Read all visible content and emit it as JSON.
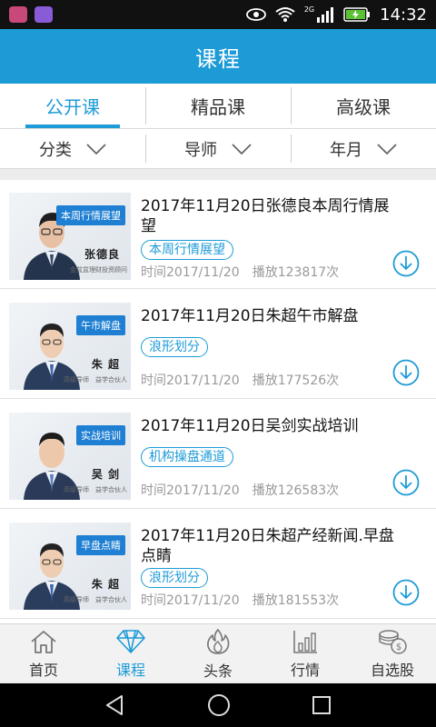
{
  "status": {
    "time": "14:32",
    "network": "2G"
  },
  "header": {
    "title": "课程"
  },
  "tabs": [
    {
      "label": "公开课",
      "active": true
    },
    {
      "label": "精品课",
      "active": false
    },
    {
      "label": "高级课",
      "active": false
    }
  ],
  "filters": [
    {
      "label": "分类"
    },
    {
      "label": "导师"
    },
    {
      "label": "年月"
    }
  ],
  "courses": [
    {
      "title": "2017年11月20日张德良本周行情展望",
      "tag": "本周行情展望",
      "time": "时间2017/11/20",
      "plays": "播放123817次",
      "thumb_tag": "本周行情展望",
      "thumb_name": "张德良",
      "thumb_sub": "金盆盆理财投资顾问"
    },
    {
      "title": "2017年11月20日朱超午市解盘",
      "tag": "浪形划分",
      "time": "时间2017/11/20",
      "plays": "播放177526次",
      "thumb_tag": "午市解盘",
      "thumb_name": "朱 超",
      "thumb_sub": "高级导师　益学合伙人"
    },
    {
      "title": "2017年11月20日吴剑实战培训",
      "tag": "机构操盘通道",
      "time": "时间2017/11/20",
      "plays": "播放126583次",
      "thumb_tag": "实战培训",
      "thumb_name": "吴 剑",
      "thumb_sub": "高级导师　益学合伙人"
    },
    {
      "title": "2017年11月20日朱超产经新闻.早盘点睛",
      "tag": "浪形划分",
      "time": "时间2017/11/20",
      "plays": "播放181553次",
      "thumb_tag": "早盘点睛",
      "thumb_name": "朱 超",
      "thumb_sub": "高级导师　益学合伙人"
    }
  ],
  "bottom_nav": [
    {
      "label": "首页",
      "icon": "home-icon",
      "active": false
    },
    {
      "label": "课程",
      "icon": "diamond-icon",
      "active": true
    },
    {
      "label": "头条",
      "icon": "flame-icon",
      "active": false
    },
    {
      "label": "行情",
      "icon": "bar-chart-icon",
      "active": false
    },
    {
      "label": "自选股",
      "icon": "coins-icon",
      "active": false
    }
  ],
  "colors": {
    "accent": "#1d9bd7",
    "tag_blue": "#1e7fd3"
  }
}
